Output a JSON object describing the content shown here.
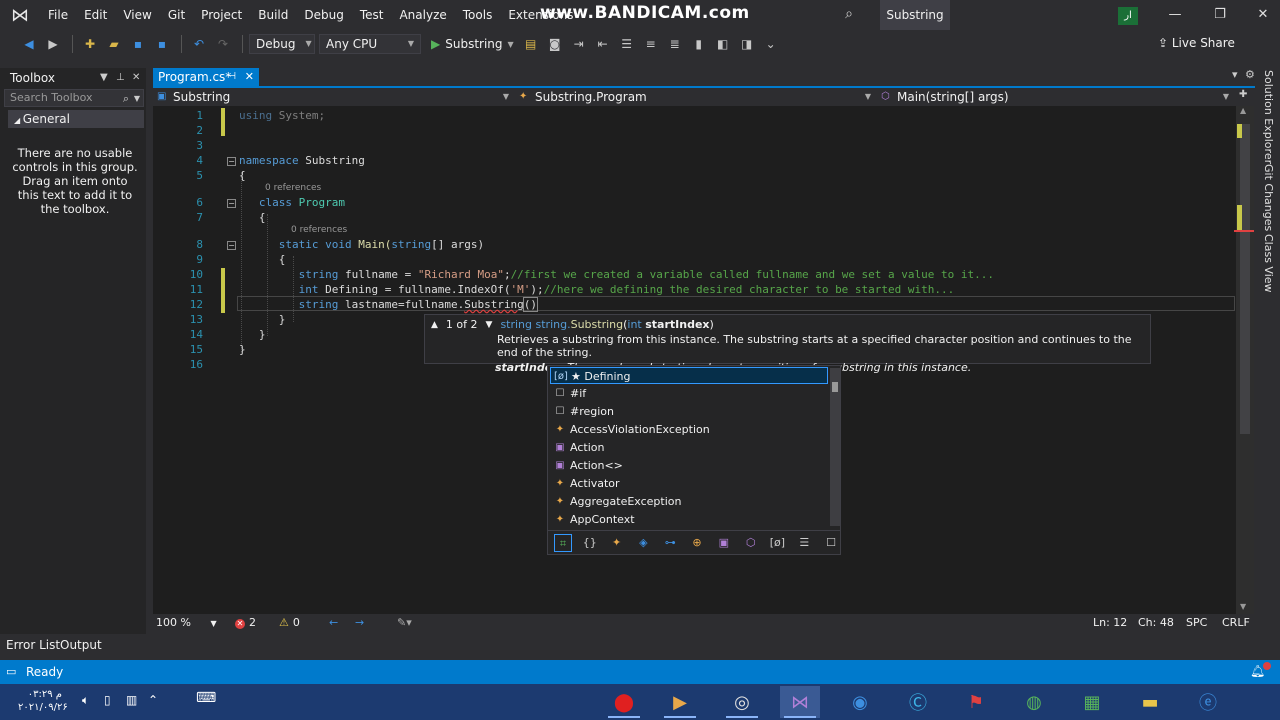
{
  "menubar": {
    "items": [
      "File",
      "Edit",
      "View",
      "Git",
      "Project",
      "Build",
      "Debug",
      "Test",
      "Analyze",
      "Tools",
      "Extensions"
    ],
    "watermark": "www.BANDICAM.com",
    "solution_title": "Substring",
    "user_initials": "ار"
  },
  "toolbar": {
    "config": "Debug",
    "platform": "Any CPU",
    "start_label": "Substring",
    "live_share": "Live Share"
  },
  "toolbox": {
    "title": "Toolbox",
    "search_placeholder": "Search Toolbox",
    "group": "General",
    "empty_message": "There are no usable controls in this group. Drag an item onto this text to add it to the toolbox."
  },
  "tabs": [
    {
      "label": "Program.cs*",
      "active": true
    }
  ],
  "navbar": {
    "project": "Substring",
    "type": "Substring.Program",
    "member": "Main(string[] args)"
  },
  "editor": {
    "line_numbers": [
      "1",
      "2",
      "3",
      "4",
      "5",
      "6",
      "7",
      "8",
      "9",
      "10",
      "11",
      "12",
      "13",
      "14",
      "15",
      "16"
    ],
    "codelens": "0 references",
    "lines": {
      "l1_using": "using",
      "l1_rest": " System;",
      "l4_ns": "namespace",
      "l4_name": " Substring",
      "l5": "{",
      "l6_class": "class",
      "l6_name": " Program",
      "l7": "{",
      "l8_static": "static",
      "l8_void": " void",
      "l8_main": " Main(",
      "l8_string": "string",
      "l8_args": "[] args)",
      "l9": "{",
      "l10_type": "string",
      "l10_var": " fullname = ",
      "l10_str": "\"Richard Moa\"",
      "l10_semi": ";",
      "l10_comment": "//first we created a variable called fullname and we set a value to it...",
      "l11_type": "int",
      "l11_code": " Defining = fullname.IndexOf(",
      "l11_str": "'M'",
      "l11_close": ");",
      "l11_comment": "//here we defining the desired character to be started with...",
      "l12_type": "string",
      "l12_code": " lastname=fullname.",
      "l12_method": "Substring",
      "l12_paren": "()",
      "l13": "}",
      "l14": "}",
      "l15": "}"
    }
  },
  "signature_help": {
    "counter": "1 of 2",
    "ret_type": "string",
    "type_prefix": "string.",
    "method": "Substring",
    "param_type": "int",
    "param_name": "startIndex",
    "description": "Retrieves a substring from this instance. The substring starts at a specified character position and continues to the end of the string.",
    "param_label": "startIndex:",
    "param_desc": "The zero-based starting character position of a substring in this instance."
  },
  "completion": {
    "items": [
      {
        "label": "★ Defining",
        "icon": "variable-icon",
        "glyph": "[ø]"
      },
      {
        "label": "#if",
        "icon": "snippet-icon",
        "glyph": "☐"
      },
      {
        "label": "#region",
        "icon": "snippet-icon",
        "glyph": "☐"
      },
      {
        "label": "AccessViolationException",
        "icon": "class-icon",
        "glyph": "✦"
      },
      {
        "label": "Action",
        "icon": "delegate-icon",
        "glyph": "▣"
      },
      {
        "label": "Action<>",
        "icon": "delegate-icon",
        "glyph": "▣"
      },
      {
        "label": "Activator",
        "icon": "class-icon",
        "glyph": "✦"
      },
      {
        "label": "AggregateException",
        "icon": "class-icon",
        "glyph": "✦"
      },
      {
        "label": "AppContext",
        "icon": "class-icon",
        "glyph": "✦"
      }
    ],
    "filter_glyphs": [
      "⌗",
      "{}",
      "✦",
      "◈",
      "⊶",
      "⊕",
      "▣",
      "⬡",
      "[ø]",
      "☰",
      "☐"
    ]
  },
  "side_tabs": [
    "Solution Explorer",
    "Git Changes",
    "Class View"
  ],
  "editor_status": {
    "zoom": "100 %",
    "errors": "2",
    "warnings": "0",
    "line": "Ln: 12",
    "col": "Ch: 48",
    "mode": "SPC",
    "eol": "CRLF"
  },
  "bottom_tabs": [
    "Error List",
    "Output"
  ],
  "statusbar": {
    "text": "Ready"
  },
  "taskbar": {
    "time": "۰۳:۲۹ م",
    "date": "۲۰۲۱/۰۹/۲۶"
  },
  "colors": {
    "accent": "#007acc",
    "editor_bg": "#1e1e1e",
    "keyword": "#569cd6",
    "type": "#4ec9b0",
    "string": "#d69d85",
    "comment": "#57a64a",
    "taskbar": "#1c3a70"
  }
}
